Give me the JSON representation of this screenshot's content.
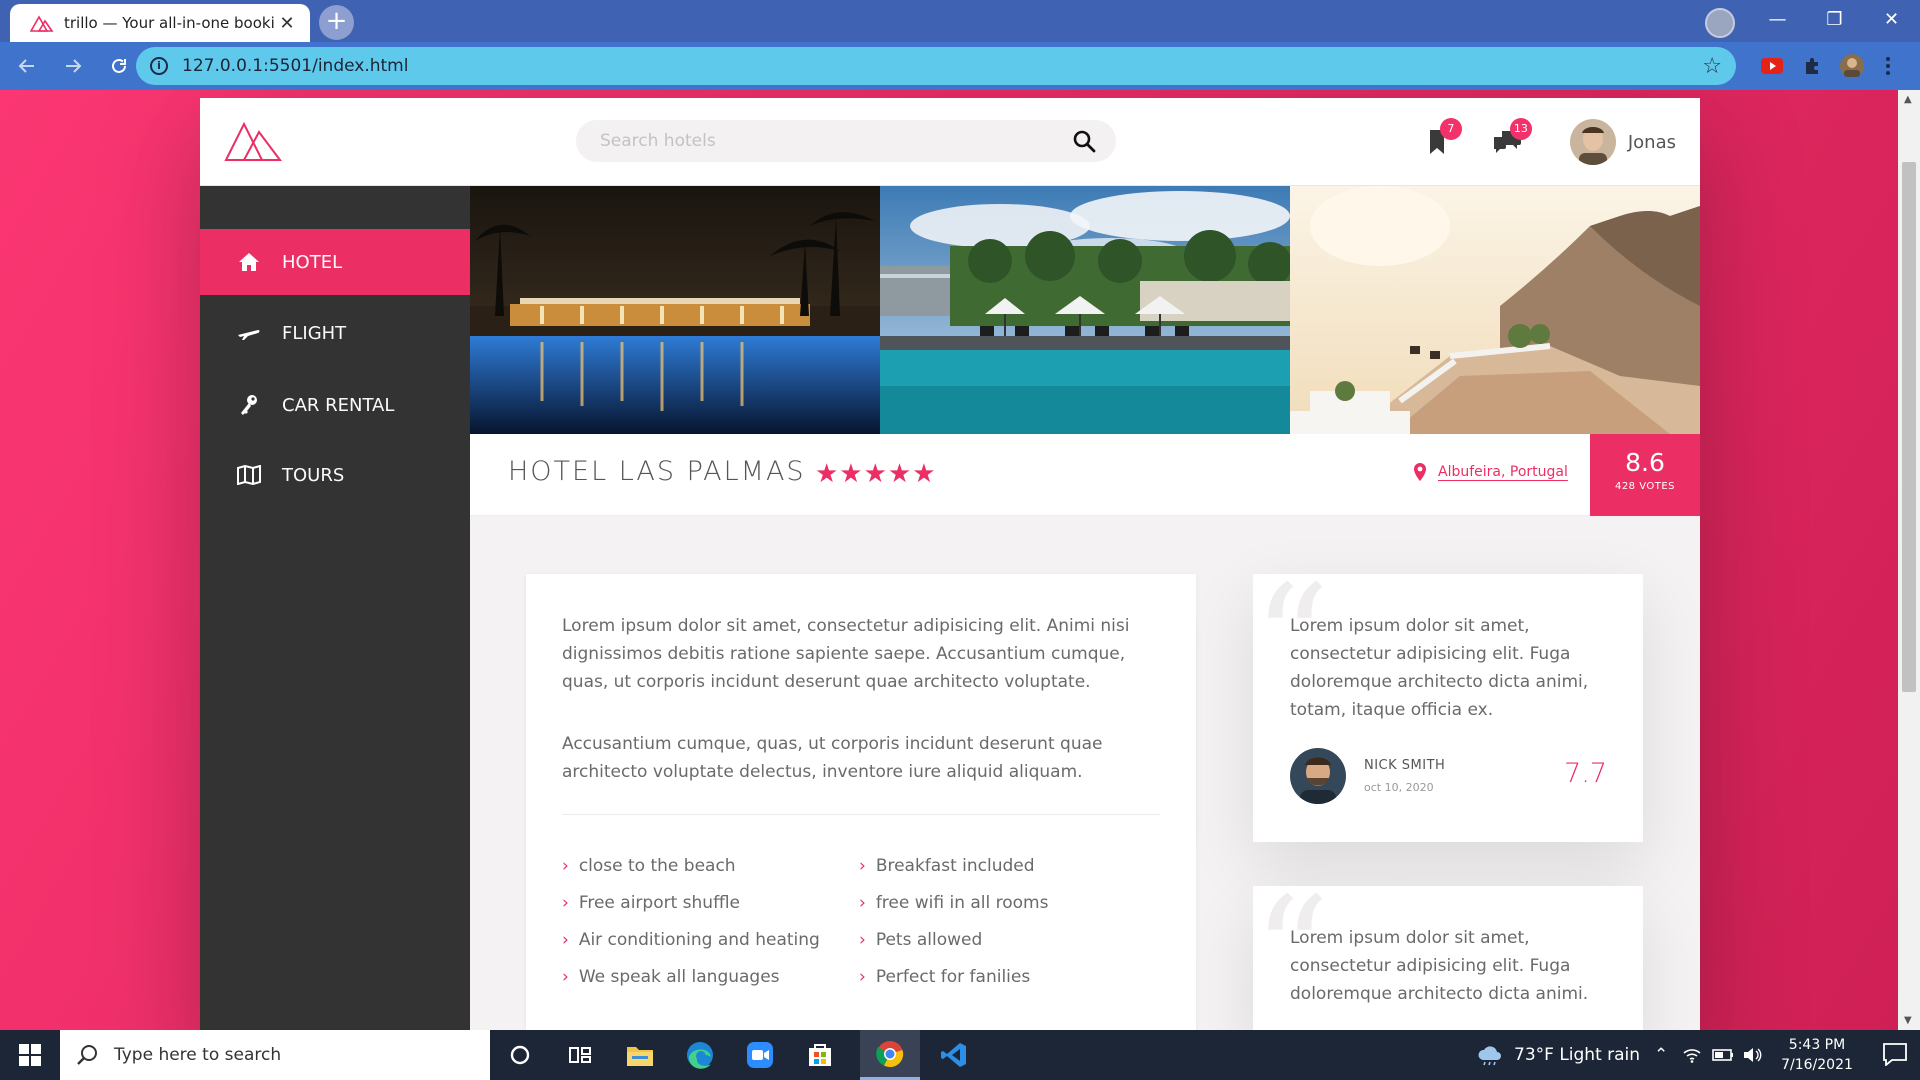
{
  "browser": {
    "tab_title": "trillo — Your all-in-one booking app",
    "tab_close": "✕",
    "new_tab": "+",
    "url": "127.0.0.1:5501/index.html",
    "window_controls": [
      "—",
      "❐",
      "✕"
    ]
  },
  "header": {
    "search_placeholder": "Search hotels",
    "bookmarks_count": "7",
    "messages_count": "13",
    "user_name": "Jonas"
  },
  "sidebar": {
    "items": [
      {
        "label": "HOTEL",
        "icon": "home-icon",
        "active": true
      },
      {
        "label": "FLIGHT",
        "icon": "plane-icon",
        "active": false
      },
      {
        "label": "CAR RENTAL",
        "icon": "key-icon",
        "active": false
      },
      {
        "label": "TOURS",
        "icon": "map-icon",
        "active": false
      }
    ]
  },
  "hotel": {
    "name": "HOTEL LAS PALMAS",
    "stars": "★★★★★",
    "location": "Albufeira, Portugal",
    "rating_average": "8.6",
    "rating_count": "428 VOTES"
  },
  "description": {
    "paragraph_1": "Lorem ipsum dolor sit amet, consectetur adipisicing elit. Animi nisi dignissimos debitis ratione sapiente saepe. Accusantium cumque, quas, ut corporis incidunt deserunt quae architecto voluptate.",
    "paragraph_2": "Accusantium cumque, quas, ut corporis incidunt deserunt quae architecto voluptate delectus, inventore iure aliquid aliquam.",
    "chevron": "›",
    "features": [
      "close to the beach",
      "Breakfast included",
      "Free airport shuffle",
      "free wifi in all rooms",
      "Air conditioning and heating",
      "Pets allowed",
      "We speak all languages",
      "Perfect for fanilies"
    ]
  },
  "reviews": [
    {
      "text": "Lorem ipsum dolor sit amet, consectetur adipisicing elit. Fuga doloremque architecto dicta animi, totam, itaque officia ex.",
      "name": "NICK SMITH",
      "date": "oct 10, 2020",
      "rating": "7.7"
    },
    {
      "text": "Lorem ipsum dolor sit amet, consectetur adipisicing elit. Fuga doloremque architecto dicta animi."
    }
  ],
  "taskbar": {
    "search_text": "Type here to search",
    "weather": "73°F  Light rain",
    "time": "5:43 PM",
    "date": "7/16/2021"
  },
  "colors": {
    "primary": "#eb2f64",
    "sidebar": "#333333",
    "background_gradient": [
      "#fb3672",
      "#cf2055"
    ]
  }
}
